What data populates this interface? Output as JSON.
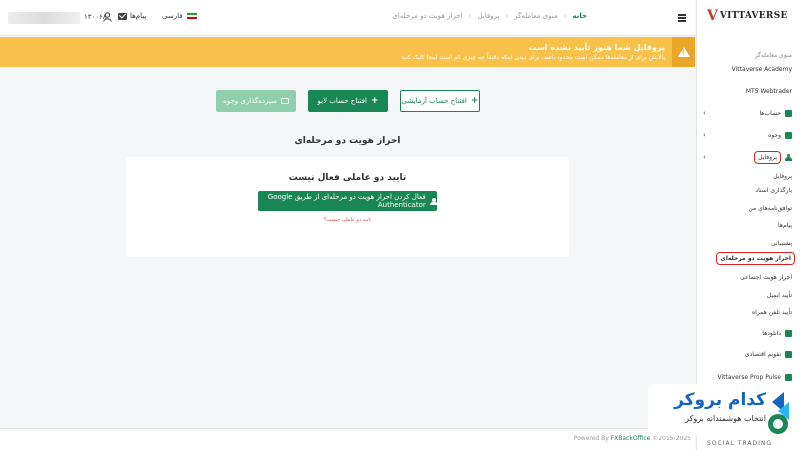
{
  "topbar": {
    "user_id": "۱۳۰۰۶۸",
    "messages_label": "پیام‌ها",
    "language_label": "فارسی",
    "breadcrumb": [
      "خانه",
      "منوی معامله‌گر",
      "پروفایل",
      "احراز هویت دو مرحله‌ای"
    ]
  },
  "banner": {
    "title": "پروفایل شما هنوز تأیید نشده است",
    "subtitle": "پالایش برای از معامله‌ها ممکن است محدود باشد. برای دیدن اینکه دقیقاً چه چیزی کم است اینجا کلیک کنید"
  },
  "actions": {
    "demo": "افتتاح حساب آزمایشی",
    "real": "افتتاح حساب لایو",
    "deposit": "سپرده‌گذاری وجوه"
  },
  "main": {
    "section_title": "احراز هویت دو مرحله‌ای",
    "card_title": "تایید دو عاملی فعال نیست",
    "enable_button": "فعال کردن احراز هویت دو مرحله‌ای از طریق Google Authenticator",
    "why_link": "تایید دو عاملی چیست؟"
  },
  "footer": {
    "powered": "Powered By",
    "brand": "FXBackOffice",
    "years": "©2015-2025"
  },
  "sidebar": {
    "logo_mark": "V",
    "logo_text": "VITTAVERSE",
    "trader_menu": "منوی معامله‌گر",
    "academy": "Vittaverse Academy",
    "webtrader": "MT5 Webtrader",
    "accounts": "حساب‌ها",
    "funds": "وجوه",
    "profile": "پروفایل",
    "profile_sub": "پروفایل",
    "upload_docs": "بارگذاری اسناد",
    "agreements": "توافق‌نامه‌های من",
    "messages": "پیام‌ها",
    "support": "پشتیبانی",
    "two_factor": "احراز هویت دو مرحله‌ای",
    "social_auth": "احراز هویت اجتماعی",
    "email_verify": "تأیید ایمیل",
    "phone_verify": "تأیید تلفن همراه",
    "downloads": "دانلودها",
    "calendar": "تقویم اقتصادی",
    "prop_pulse": "Vittaverse Prop Pulse",
    "social_trading": "SOCIAL TRADING"
  },
  "watermark": {
    "main": "کدام بروکر",
    "sub": "انتخاب هوشمندانه بروکر"
  },
  "colors": {
    "accent": "#198754",
    "warning": "#f7c14a",
    "highlight": "#e02020"
  }
}
